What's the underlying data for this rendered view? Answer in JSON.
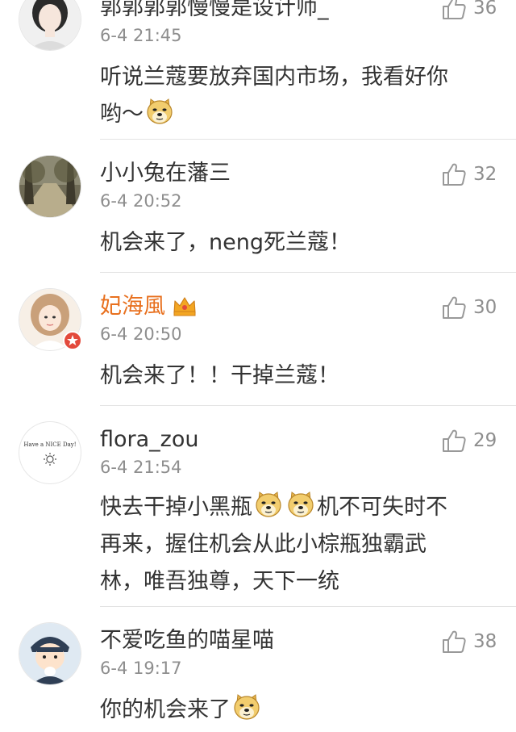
{
  "comments": [
    {
      "username": "郭郭郭郭慢慢是设计师_",
      "time": "6-4 21:45",
      "likes": "36",
      "text_parts": [
        "听说兰蔻要放弃国内市场，我看好你",
        "哟～"
      ],
      "emoji": "doge-emoji",
      "avatar_icon": "girl-portrait-avatar"
    },
    {
      "username": "小小兔在藩三",
      "time": "6-4 20:52",
      "likes": "32",
      "text": "机会来了，neng死兰蔻！",
      "avatar_icon": "forest-path-avatar"
    },
    {
      "username": "妃海風",
      "time": "6-4 20:50",
      "likes": "30",
      "text": "机会来了！！干掉兰蔻！",
      "avatar_icon": "girl-avatar",
      "badge_icon": "verified-star-badge-icon",
      "vip_icon": "vip-crown-icon",
      "username_color": "#e8701e"
    },
    {
      "username": "flora_zou",
      "time": "6-4 21:54",
      "likes": "29",
      "text_parts": [
        "快去干掉小黑瓶",
        "机不可失时不",
        "再来，握住机会从此小棕瓶独霸武",
        "林，唯吾独尊，天下一统"
      ],
      "avatar_text": "Have a NICE Day!",
      "avatar_icon": "sun-icon"
    },
    {
      "username": "不爱吃鱼的喵星喵",
      "time": "6-4 19:17",
      "likes": "38",
      "text": "你的机会来了",
      "avatar_icon": "cartoon-character-avatar"
    }
  ],
  "like_icon": "thumbs-up-icon",
  "colors": {
    "text": "#333333",
    "meta": "#8e8e8e",
    "vip_name": "#e8701e",
    "divider": "#e3e3e3"
  }
}
